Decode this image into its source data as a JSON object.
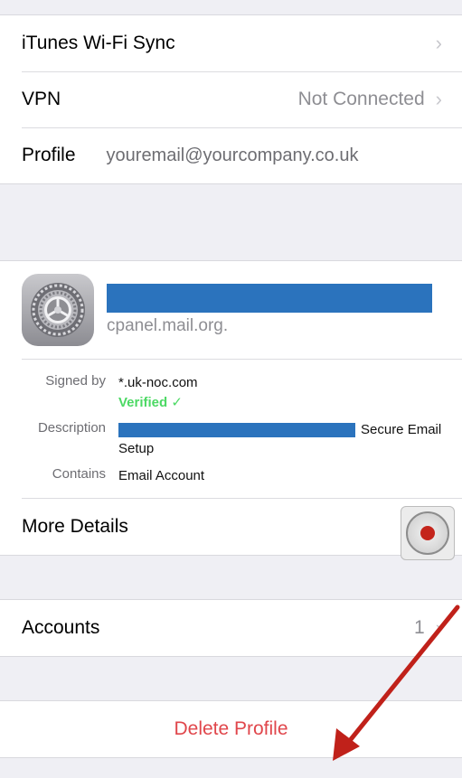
{
  "top_group": {
    "rows": [
      {
        "label": "iTunes Wi-Fi Sync",
        "value": "",
        "chevron": "›"
      },
      {
        "label": "VPN",
        "value": "Not Connected",
        "chevron": "›"
      },
      {
        "label": "Profile",
        "value": "youremail@yourcompany.co.uk"
      }
    ]
  },
  "profile": {
    "subtitle": "cpanel.mail.org.",
    "icon": "settings-gear-icon",
    "signed_by_label": "Signed by",
    "signed_by_value": "*.uk-noc.com",
    "verified_text": "Verified ✓",
    "description_label": "Description",
    "description_value": "Secure Email Setup",
    "contains_label": "Contains",
    "contains_value": "Email Account",
    "more_details_label": "More Details"
  },
  "accounts": {
    "label": "Accounts",
    "count": "1",
    "chevron": "›"
  },
  "delete": {
    "label": "Delete Profile"
  },
  "colors": {
    "background": "#efeff4",
    "verified": "#4cd964",
    "delete": "#e0464b",
    "redaction": "#2b73bd",
    "annotation_arrow": "#c0211a"
  }
}
